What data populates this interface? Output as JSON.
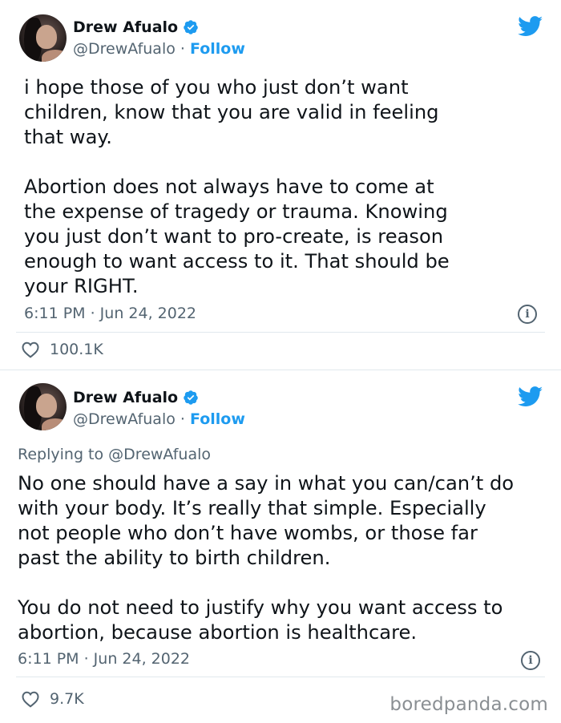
{
  "tweets": [
    {
      "author": "Drew Afualo",
      "handle": "@DrewAfualo",
      "separator": "·",
      "follow_label": "Follow",
      "text": "i hope those of you who just don’t want\nchildren, know that you are valid in feeling\nthat way.\n\nAbortion does not always have to come at\nthe expense of tragedy or trauma. Knowing\nyou just don’t want to pro-create, is reason\nenough to want access to it. That should be\nyour RIGHT.",
      "timestamp": "6:11 PM · Jun 24, 2022",
      "likes": "100.1K"
    },
    {
      "author": "Drew Afualo",
      "handle": "@DrewAfualo",
      "separator": "·",
      "follow_label": "Follow",
      "replying_prefix": "Replying to",
      "replying_to": "@DrewAfualo",
      "text": "No one should have a say in what you can/can’t do\nwith your body. It’s really that simple. Especially\nnot people who don’t have wombs, or those far\npast the ability to birth children.\n\nYou do not need to justify why you want access to\nabortion, because abortion is healthcare.",
      "timestamp": "6:11 PM · Jun 24, 2022",
      "likes": "9.7K"
    }
  ],
  "watermark": "boredpanda.com",
  "icons": {
    "verified": "verified-badge-icon",
    "brand": "twitter-bird-icon",
    "info": "info-icon",
    "like": "heart-icon"
  },
  "colors": {
    "brand_blue": "#1d9bf0",
    "text": "#0f1419",
    "secondary": "#536471"
  }
}
